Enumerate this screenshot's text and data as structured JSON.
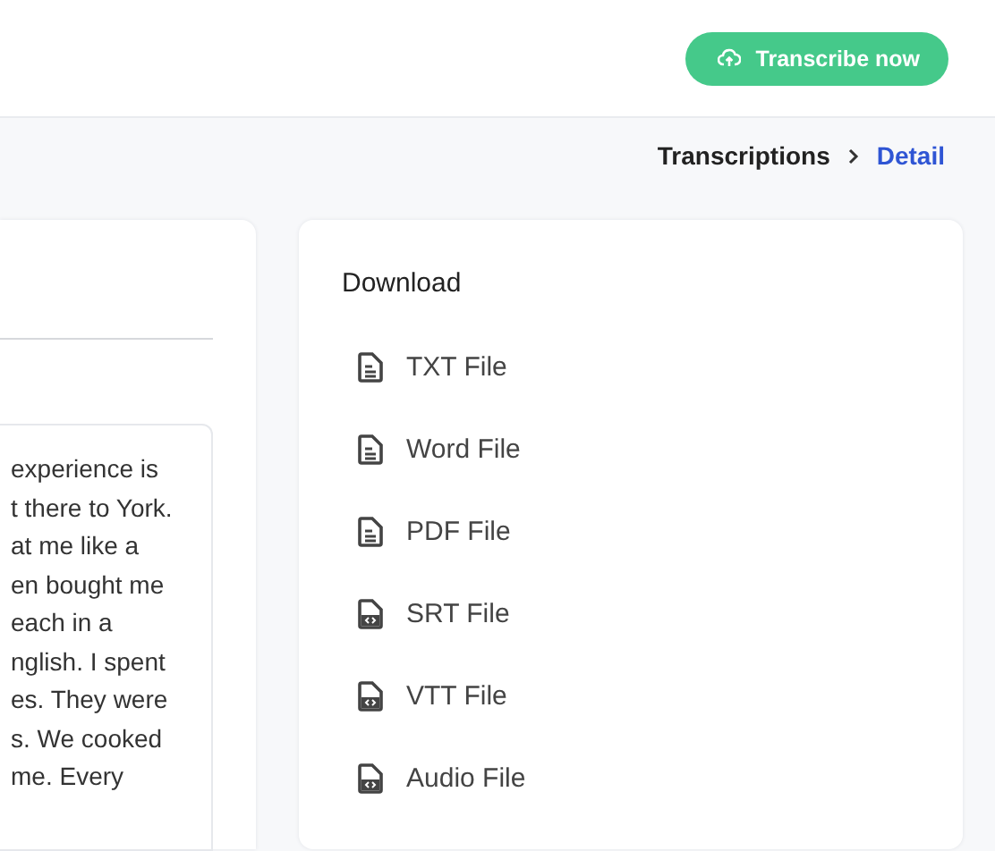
{
  "header": {
    "action_button": "Transcribe now"
  },
  "breadcrumb": [
    {
      "label": "Transcriptions",
      "selected": false
    },
    {
      "label": "Detail",
      "selected": true
    }
  ],
  "transcript": {
    "lines": [
      "experience is",
      "t there to York.",
      "at me like a",
      "en bought me",
      "each in a",
      "nglish. I spent",
      "es. They were",
      "s. We cooked",
      "me. Every"
    ]
  },
  "download": {
    "title": "Download",
    "items": [
      {
        "label": "TXT File",
        "kind": "text"
      },
      {
        "label": "Word File",
        "kind": "text"
      },
      {
        "label": "PDF File",
        "kind": "text"
      },
      {
        "label": "SRT File",
        "kind": "code"
      },
      {
        "label": "VTT File",
        "kind": "code"
      },
      {
        "label": "Audio File",
        "kind": "code"
      }
    ]
  }
}
